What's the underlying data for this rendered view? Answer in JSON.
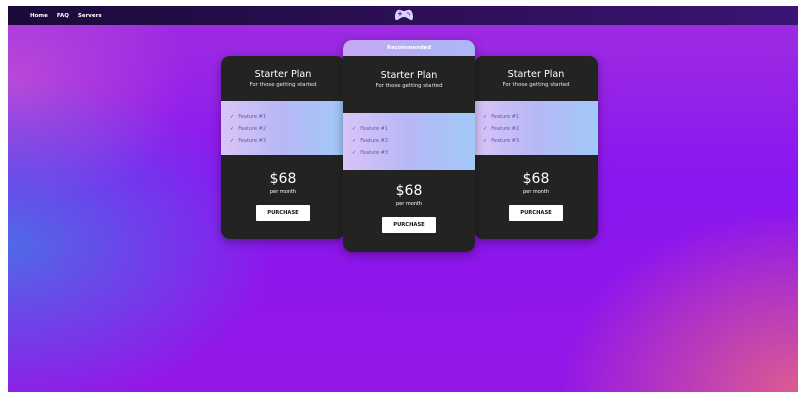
{
  "nav": {
    "items": [
      "Home",
      "FAQ",
      "Servers"
    ]
  },
  "logo": {
    "icon": "gamepad-icon"
  },
  "colors": {
    "topbar": "#2c0f55",
    "card_bg": "#232323",
    "badge": "#b9aef6",
    "feature_band": "#b7b8f6",
    "button_bg": "#ffffff"
  },
  "plans": [
    {
      "badge": "",
      "title": "Starter Plan",
      "subtitle": "For those getting started",
      "features": [
        "Feature #1",
        "Feature #2",
        "Feature #3"
      ],
      "price": "$68",
      "period": "per month",
      "button": "PURCHASE"
    },
    {
      "badge": "Recommended",
      "title": "Starter Plan",
      "subtitle": "For those getting started",
      "features": [
        "Feature #1",
        "Feature #2",
        "Feature #3"
      ],
      "price": "$68",
      "period": "per month",
      "button": "PURCHASE"
    },
    {
      "badge": "",
      "title": "Starter Plan",
      "subtitle": "For those getting started",
      "features": [
        "Feature #1",
        "Feature #2",
        "Feature #3"
      ],
      "price": "$68",
      "period": "per month",
      "button": "PURCHASE"
    }
  ],
  "icons": {
    "check": "✓"
  }
}
